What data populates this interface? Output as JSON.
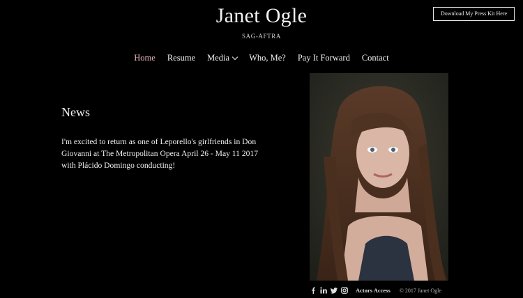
{
  "header": {
    "title": "Janet Ogle",
    "tagline": "SAG-AFTRA",
    "press_kit_button": "Download My Press Kit Here"
  },
  "nav": {
    "items": [
      {
        "label": "Home",
        "active": true
      },
      {
        "label": "Resume"
      },
      {
        "label": "Media",
        "has_dropdown": true
      },
      {
        "label": "Who, Me?"
      },
      {
        "label": "Pay It Forward"
      },
      {
        "label": "Contact"
      }
    ]
  },
  "news": {
    "heading": "News",
    "body": "I'm excited to return as one of Leporello's girlfriends in Don Giovanni at The Metropolitan Opera April 26 - May 11 2017 with Plácido Domingo conducting!"
  },
  "photo": {
    "icon": "portrait-photo"
  },
  "footer": {
    "social_icons": [
      "facebook-icon",
      "linkedin-icon",
      "twitter-icon",
      "instagram-icon"
    ],
    "actors_access": "Actors Access",
    "copyright": "© 2017 Janet Ogle"
  },
  "colors": {
    "background": "#000000",
    "text": "#f0f0f0",
    "active_nav": "#e6b3b8"
  }
}
